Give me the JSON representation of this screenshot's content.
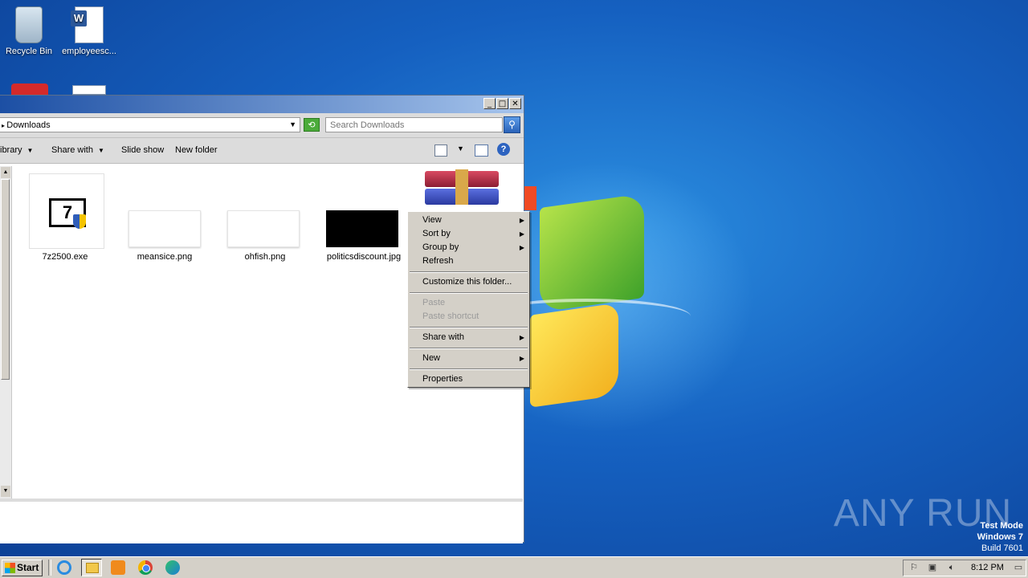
{
  "desktop": {
    "icons": [
      {
        "label": "Recycle Bin",
        "icon": "recycle-bin-icon"
      },
      {
        "label": "employeesc...",
        "icon": "word-document-icon"
      }
    ]
  },
  "explorer": {
    "window_buttons": {
      "minimize": "_",
      "maximize": "□",
      "close": "✕"
    },
    "address": {
      "path": "Downloads"
    },
    "search": {
      "placeholder": "Search Downloads"
    },
    "toolbar": {
      "library_label": "ibrary",
      "share_label": "Share with",
      "slideshow_label": "Slide show",
      "newfolder_label": "New folder",
      "help_label": "?"
    },
    "files": [
      {
        "name": "7z2500.exe",
        "icon": "7zip-installer-icon"
      },
      {
        "name": "meansice.png",
        "icon": "image-thumbnail"
      },
      {
        "name": "ohfish.png",
        "icon": "image-thumbnail"
      },
      {
        "name": "politicsdiscount.jpg",
        "icon": "image-thumbnail"
      },
      {
        "name": "",
        "icon": "winrar-icon"
      }
    ]
  },
  "context_menu": {
    "items": [
      {
        "label": "View",
        "submenu": true,
        "enabled": true
      },
      {
        "label": "Sort by",
        "submenu": true,
        "enabled": true
      },
      {
        "label": "Group by",
        "submenu": true,
        "enabled": true
      },
      {
        "label": "Refresh",
        "submenu": false,
        "enabled": true
      },
      {
        "label": "Customize this folder...",
        "submenu": false,
        "enabled": true
      },
      {
        "label": "Paste",
        "submenu": false,
        "enabled": false
      },
      {
        "label": "Paste shortcut",
        "submenu": false,
        "enabled": false
      },
      {
        "label": "Share with",
        "submenu": true,
        "enabled": true
      },
      {
        "label": "New",
        "submenu": true,
        "enabled": true
      },
      {
        "label": "Properties",
        "submenu": false,
        "enabled": true
      }
    ]
  },
  "watermark": {
    "brand": "ANY RUN",
    "test_mode": "Test Mode",
    "os": "Windows 7",
    "build": "Build 7601"
  },
  "taskbar": {
    "start_label": "Start",
    "clock": "8:12 PM"
  },
  "colors": {
    "desktop_blue": "#1560c0",
    "menu_gray": "#d4d0c8"
  }
}
